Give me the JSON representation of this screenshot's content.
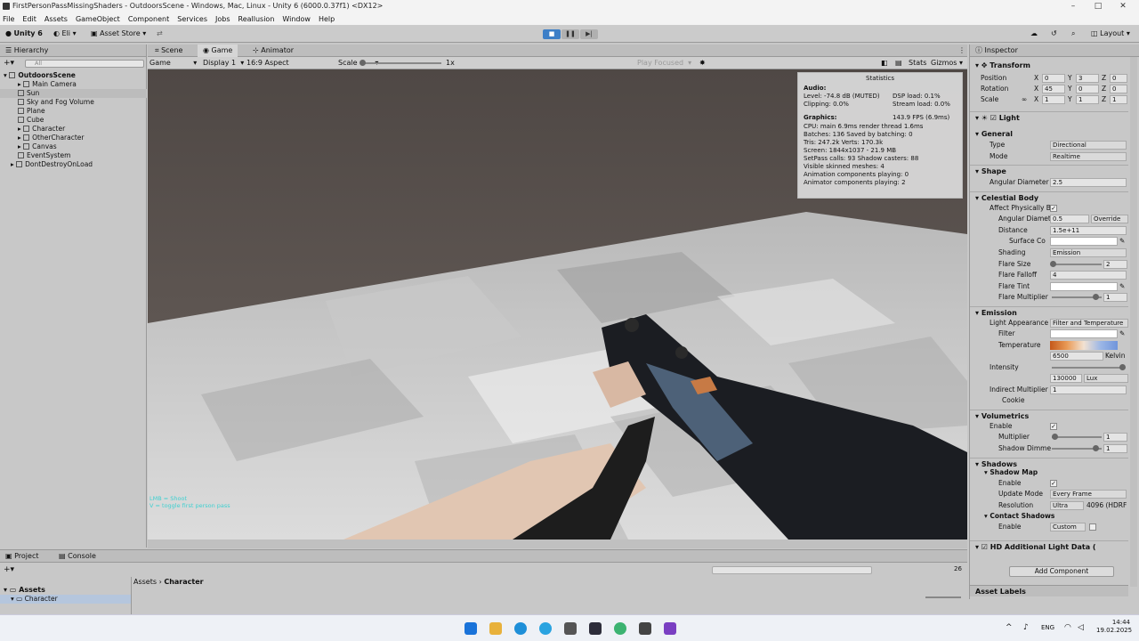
{
  "window": {
    "title": "FirstPersonPassMissingShaders - OutdoorsScene - Windows, Mac, Linux - Unity 6 (6000.0.37f1) <DX12>",
    "minimize": "–",
    "maximize": "□",
    "close": "✕"
  },
  "menu": [
    "File",
    "Edit",
    "Assets",
    "GameObject",
    "Component",
    "Services",
    "Jobs",
    "Reallusion",
    "Window",
    "Help"
  ],
  "toolbar": {
    "unity": "Unity 6",
    "account": "Eli",
    "asset_store": "Asset Store",
    "layout": "Layout"
  },
  "hierarchy": {
    "title": "Hierarchy",
    "search_placeholder": "All",
    "items": [
      {
        "label": "OutdoorsScene",
        "indent": 0
      },
      {
        "label": "Main Camera",
        "indent": 2
      },
      {
        "label": "Sun",
        "indent": 2
      },
      {
        "label": "Sky and Fog Volume",
        "indent": 2
      },
      {
        "label": "Plane",
        "indent": 2
      },
      {
        "label": "Cube",
        "indent": 2
      },
      {
        "label": "Character",
        "indent": 2
      },
      {
        "label": "OtherCharacter",
        "indent": 2
      },
      {
        "label": "Canvas",
        "indent": 2
      },
      {
        "label": "EventSystem",
        "indent": 2
      },
      {
        "label": "DontDestroyOnLoad",
        "indent": 1
      }
    ]
  },
  "scene": {
    "tabs": [
      "Scene",
      "Game",
      "Animator"
    ],
    "game_label": "Game",
    "display": "Display 1",
    "aspect": "16:9 Aspect",
    "scale_label": "Scale",
    "scale_value": "1x",
    "play_focused": "Play Focused",
    "stats_btn": "Stats",
    "gizmos_btn": "Gizmos",
    "hint_line1": "LMB = Shoot",
    "hint_line2": "V = toggle first person pass"
  },
  "stats": {
    "title": "Statistics",
    "audio_hdr": "Audio:",
    "level": "Level: -74.8 dB (MUTED)",
    "clipping": "Clipping: 0.0%",
    "dsp": "DSP load: 0.1%",
    "stream": "Stream load: 0.0%",
    "graphics_hdr": "Graphics:",
    "fps": "143.9 FPS (6.9ms)",
    "cpu": "CPU: main 6.9ms   render thread 1.6ms",
    "batches": "Batches: 136   Saved by batching: 0",
    "tris": "Tris: 247.2k   Verts: 170.3k",
    "screen": "Screen: 1844x1037 - 21.9 MB",
    "setpass": "SetPass calls: 93   Shadow casters: 88",
    "skinned": "Visible skinned meshes: 4",
    "anim": "Animation components playing: 0",
    "animator": "Animator components playing: 2"
  },
  "inspector": {
    "title": "Inspector",
    "transform": "Transform",
    "position": {
      "label": "Position",
      "x": "0",
      "y": "3",
      "z": "0"
    },
    "rotation": {
      "label": "Rotation",
      "x": "45",
      "y": "0",
      "z": "0"
    },
    "scale": {
      "label": "Scale",
      "x": "1",
      "y": "1",
      "z": "1"
    },
    "light": "Light",
    "general": "General",
    "type_label": "Type",
    "type_value": "Directional",
    "mode_label": "Mode",
    "mode_value": "Realtime",
    "shape": "Shape",
    "angular_label": "Angular Diameter",
    "angular_value": "2.5",
    "celestial": "Celestial Body",
    "affect_label": "Affect Physically B",
    "angdiam_label": "Angular Diamete",
    "angdiam_value": "0.5",
    "override": "Override",
    "distance_label": "Distance",
    "distance_value": "1.5e+11",
    "surface_label": "Surface Co",
    "shading_label": "Shading",
    "shading_value": "Emission",
    "flaresize_label": "Flare Size",
    "flaresize_value": "2",
    "flarefalloff_label": "Flare Falloff",
    "flarefalloff_value": "4",
    "flaretint_label": "Flare Tint",
    "flaremult_label": "Flare Multiplier",
    "flaremult_value": "1",
    "emission": "Emission",
    "appearance_label": "Light Appearance",
    "appearance_value": "Filter and Temperature",
    "filter_label": "Filter",
    "temperature_label": "Temperature",
    "temperature_value": "6500",
    "kelvin": "Kelvin",
    "intensity_label": "Intensity",
    "intensity_value": "130000",
    "lux": "Lux",
    "indirect_label": "Indirect Multiplier",
    "indirect_value": "1",
    "cookie_label": "Cookie",
    "volumetrics": "Volumetrics",
    "enable_label": "Enable",
    "multiplier_label": "Multiplier",
    "multiplier_value": "1",
    "shadowdim_label": "Shadow Dimme",
    "shadowdim_value": "1",
    "shadows": "Shadows",
    "shadowmap": "Shadow Map",
    "update_label": "Update Mode",
    "update_value": "Every Frame",
    "resolution_label": "Resolution",
    "resolution_value": "Ultra",
    "resolution_extra": "4096 (HDRF",
    "contact": "Contact Shadows",
    "contact_value": "Custom",
    "hdlight": "HD Additional Light Data (",
    "add_component": "Add Component",
    "asset_labels": "Asset Labels"
  },
  "bottom": {
    "project_tab": "Project",
    "console_tab": "Console",
    "assets": "Assets",
    "character": "Character",
    "breadcrumb_assets": "Assets",
    "breadcrumb_char": "Character",
    "count": "26"
  },
  "taskbar": {
    "lang": "ENG",
    "time": "14:44",
    "date": "19.02.2025"
  }
}
